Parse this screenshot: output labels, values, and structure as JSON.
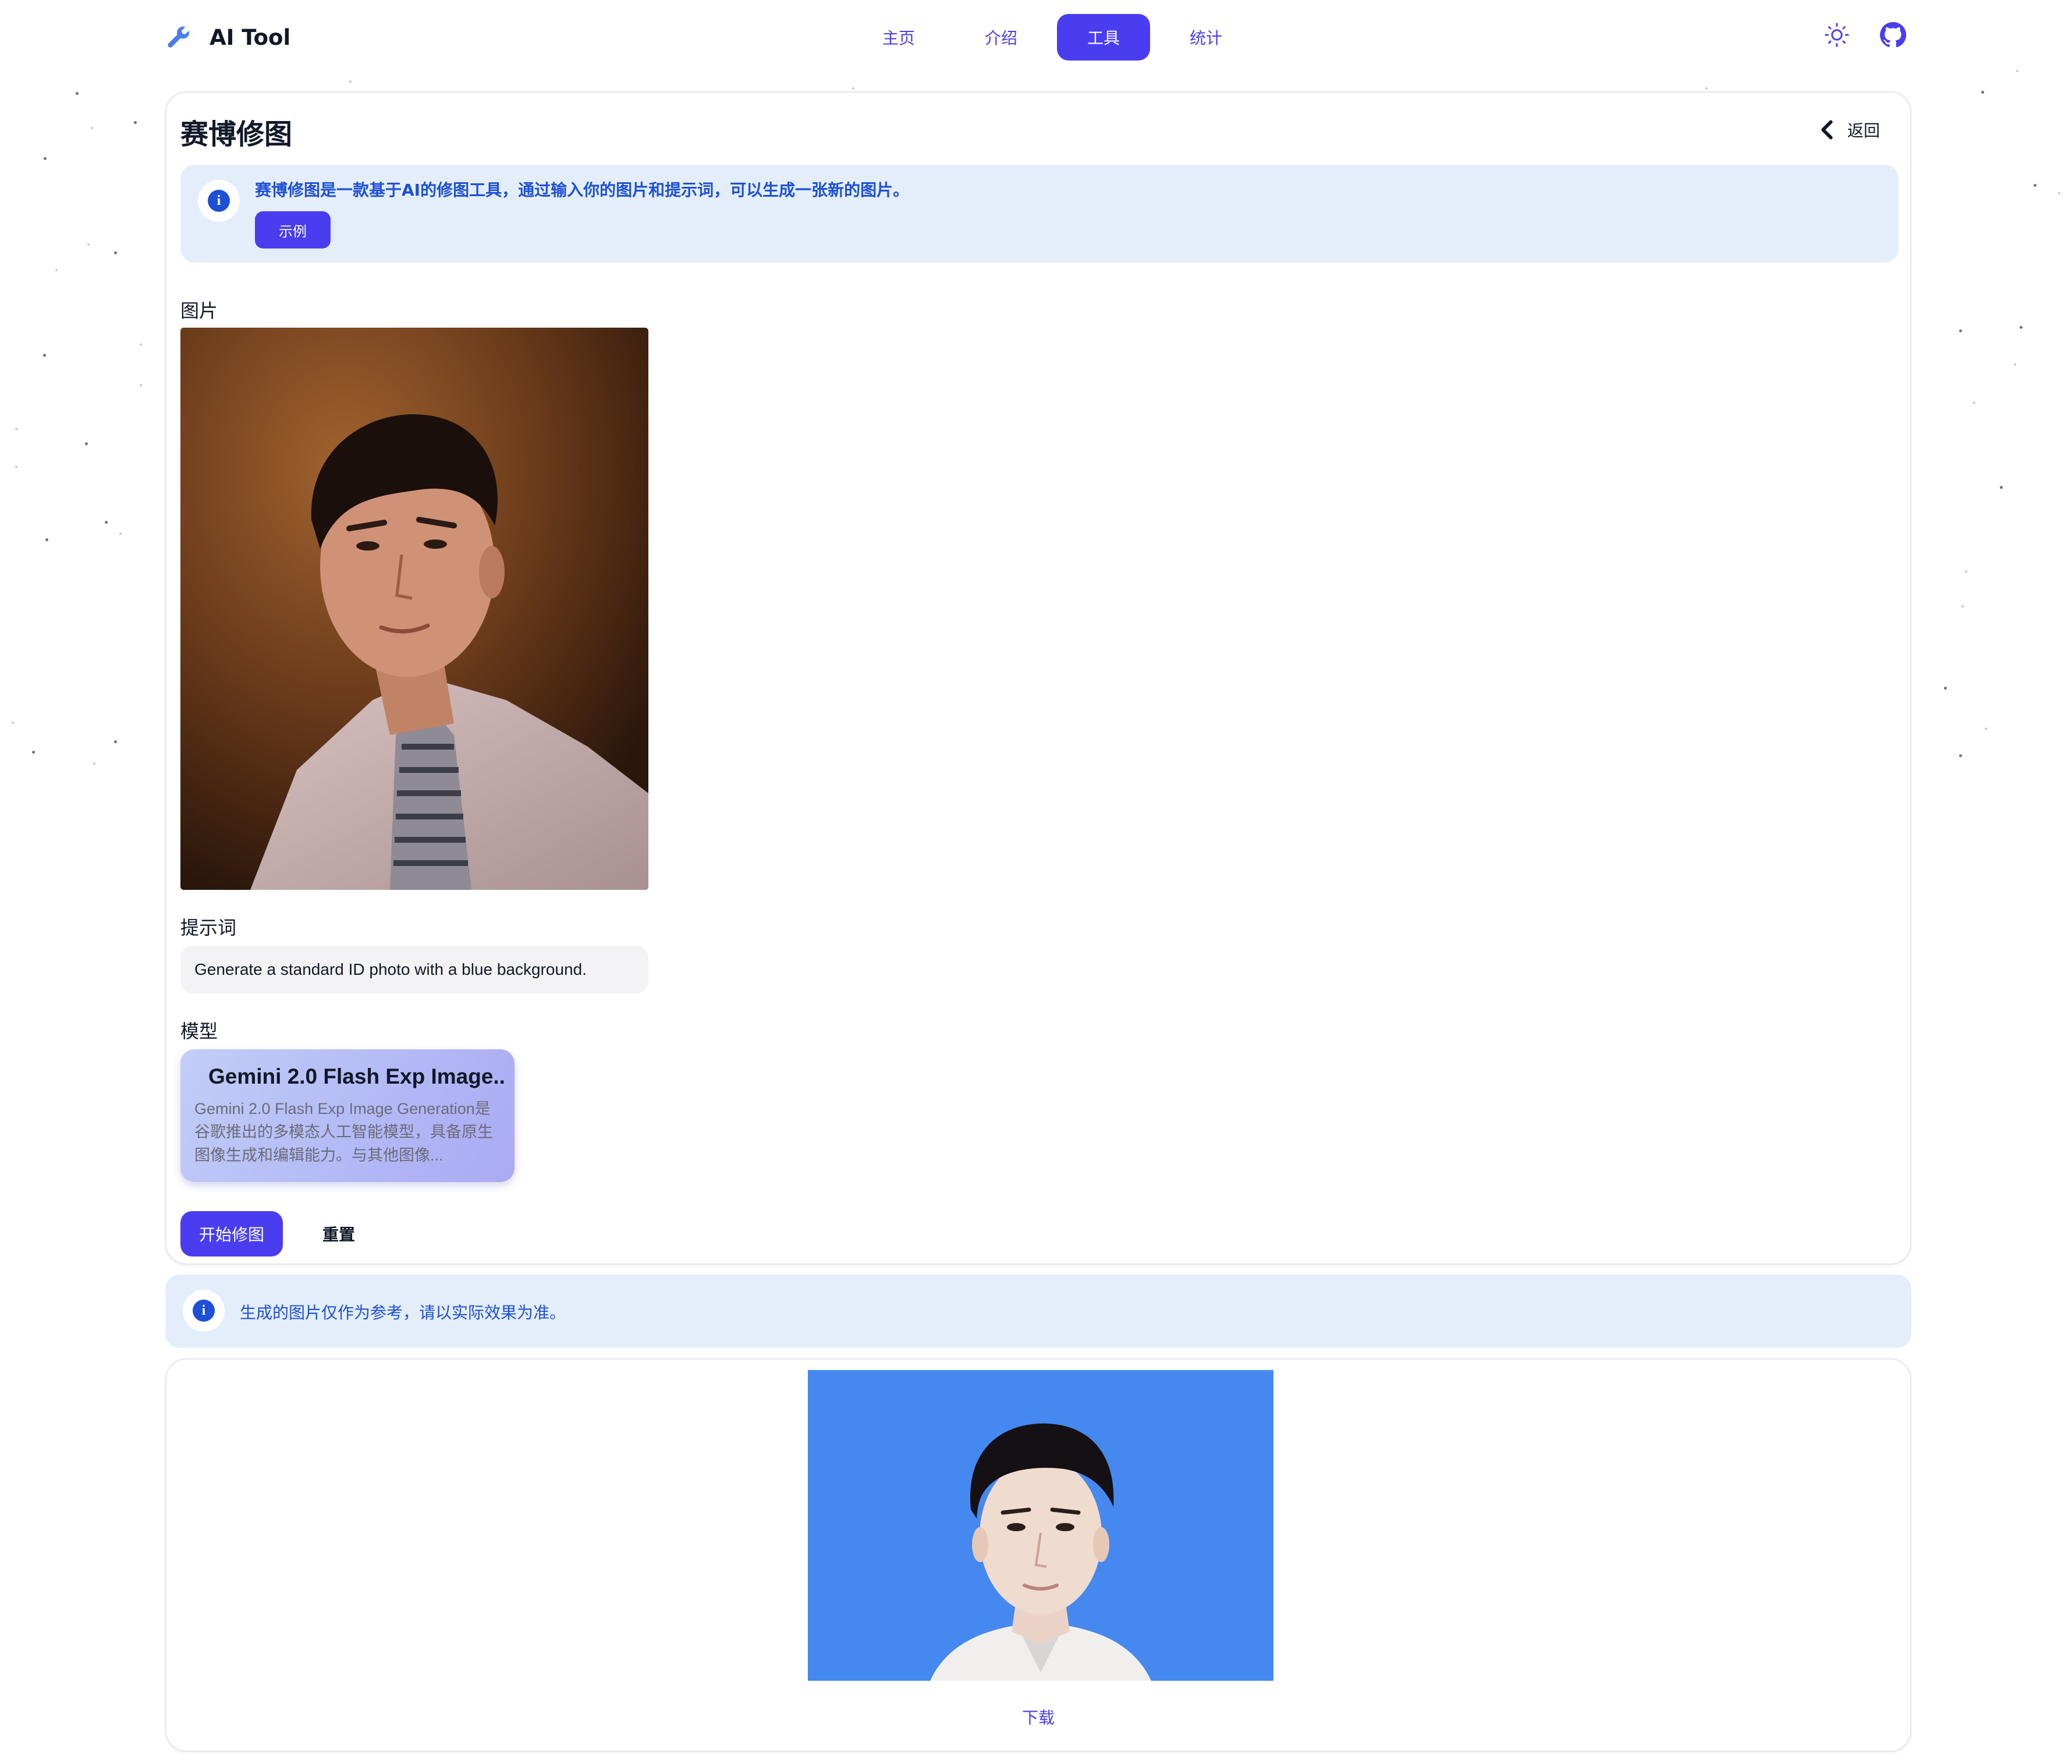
{
  "navbar": {
    "brand": "AI Tool",
    "links": [
      "主页",
      "介绍",
      "工具",
      "统计"
    ],
    "active_index": 2
  },
  "page": {
    "title": "赛博修图",
    "back_label": "返回"
  },
  "intro_alert": {
    "message": "赛博修图是一款基于AI的修图工具，通过输入你的图片和提示词，可以生成一张新的图片。",
    "example_button": "示例"
  },
  "form": {
    "image_label": "图片",
    "prompt_label": "提示词",
    "prompt_value": "Generate a standard ID photo with a blue background.",
    "model_label": "模型",
    "model": {
      "name": "Gemini 2.0 Flash Exp Image..",
      "description": "Gemini 2.0 Flash Exp Image Generation是谷歌推出的多模态人工智能模型，具备原生图像生成和编辑能力。与其他图像..."
    },
    "start_button": "开始修图",
    "reset_button": "重置"
  },
  "notice": {
    "message": "生成的图片仅作为参考，请以实际效果为准。"
  },
  "result": {
    "download_label": "下载"
  },
  "colors": {
    "accent": "#4a3df0",
    "info_bg": "#e4eefb",
    "info_text": "#1d4fd7",
    "result_bg": "#4589f0"
  },
  "icons": {
    "brand": "wrench-icon",
    "theme": "sun-icon",
    "repo": "github-icon",
    "back": "chevron-left-icon",
    "info": "info-icon"
  }
}
